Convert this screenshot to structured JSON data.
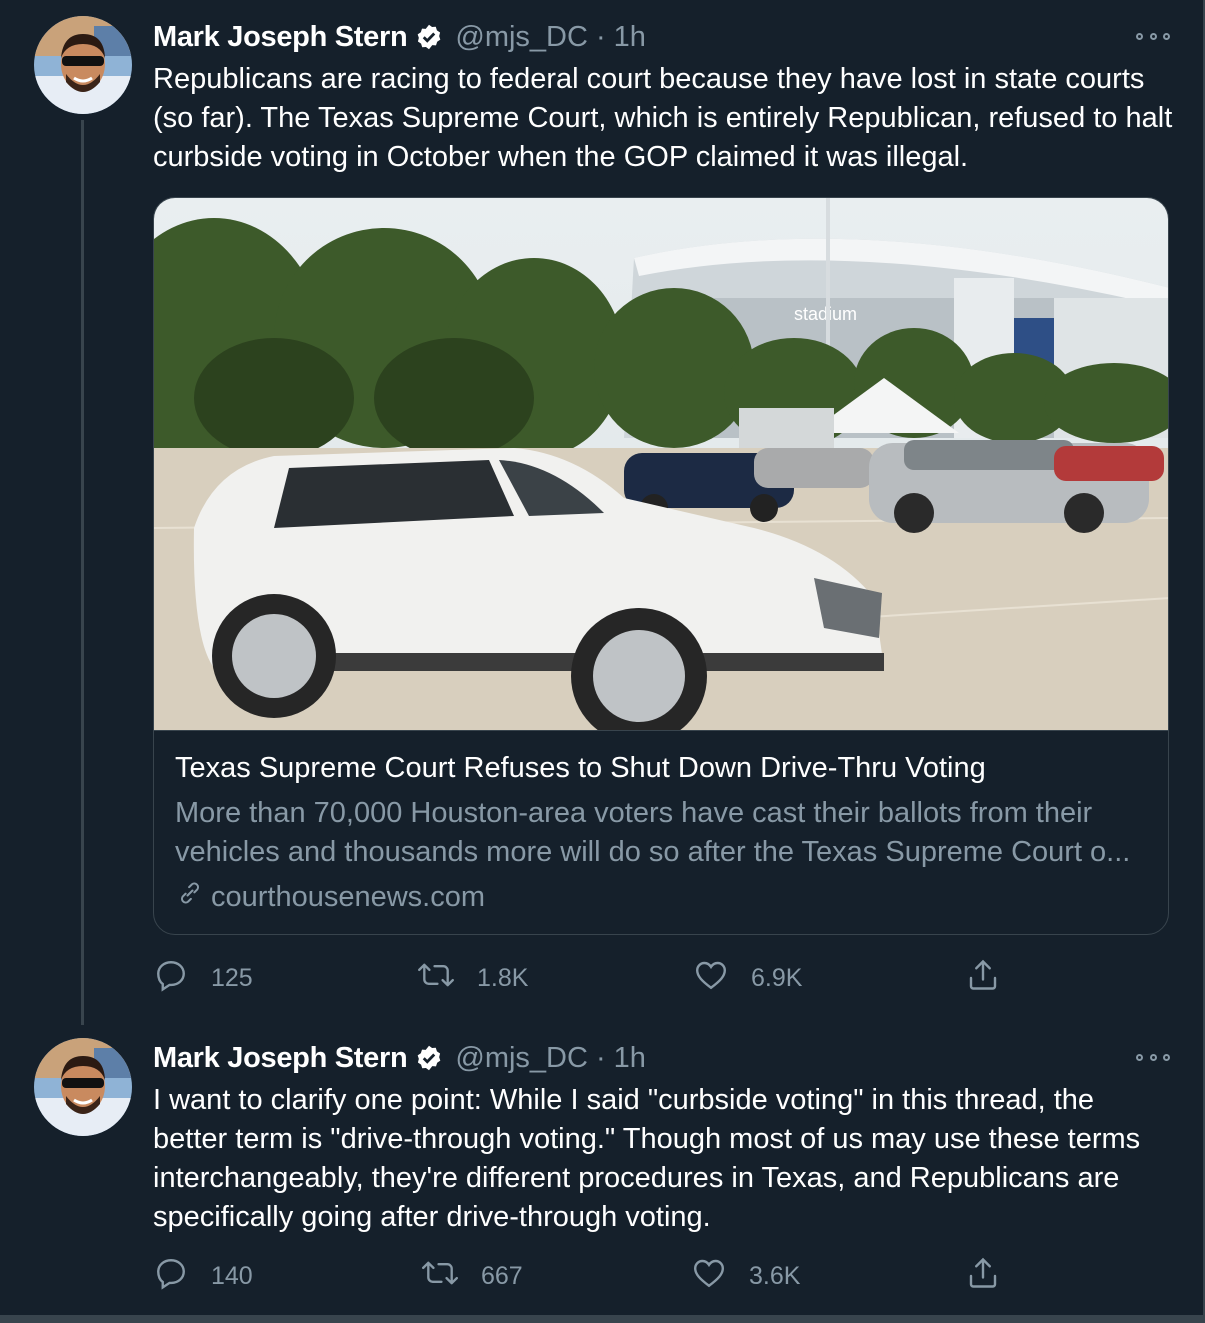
{
  "tweets": [
    {
      "author": "Mark Joseph Stern",
      "handle": "@mjs_DC",
      "separator": "·",
      "time": "1h",
      "text": "Republicans are racing to federal court because they have lost in state courts (so far). The Texas Supreme Court, which is entirely Republican, refused to halt curbside voting in October when the GOP claimed it was illegal.",
      "card": {
        "title": "Texas Supreme Court Refuses to Shut Down Drive-Thru Voting",
        "description_line1": "More than 70,000 Houston-area voters have cast their ballots from their",
        "description_line2": "vehicles and thousands more will do so after the Texas Supreme Court o...",
        "domain": "courthousenews.com",
        "image_sign": "stadium"
      },
      "replies": "125",
      "retweets": "1.8K",
      "likes": "6.9K"
    },
    {
      "author": "Mark Joseph Stern",
      "handle": "@mjs_DC",
      "separator": "·",
      "time": "1h",
      "text": "I want to clarify one point: While I said \"curbside voting\" in this thread, the better term is \"drive-through voting.\" Though most of us may use these terms interchangeably, they're different procedures in Texas, and Republicans are specifically going after drive-through voting.",
      "replies": "140",
      "retweets": "667",
      "likes": "3.6K"
    }
  ],
  "icons": {
    "verified": "verified-badge-icon",
    "more": "more-options-icon",
    "reply": "reply-icon",
    "retweet": "retweet-icon",
    "like": "like-icon",
    "share": "share-icon",
    "link": "link-icon"
  },
  "colors": {
    "background": "#15202b",
    "border": "#38444d",
    "secondary_text": "#8899a6",
    "primary_text": "#ffffff"
  }
}
